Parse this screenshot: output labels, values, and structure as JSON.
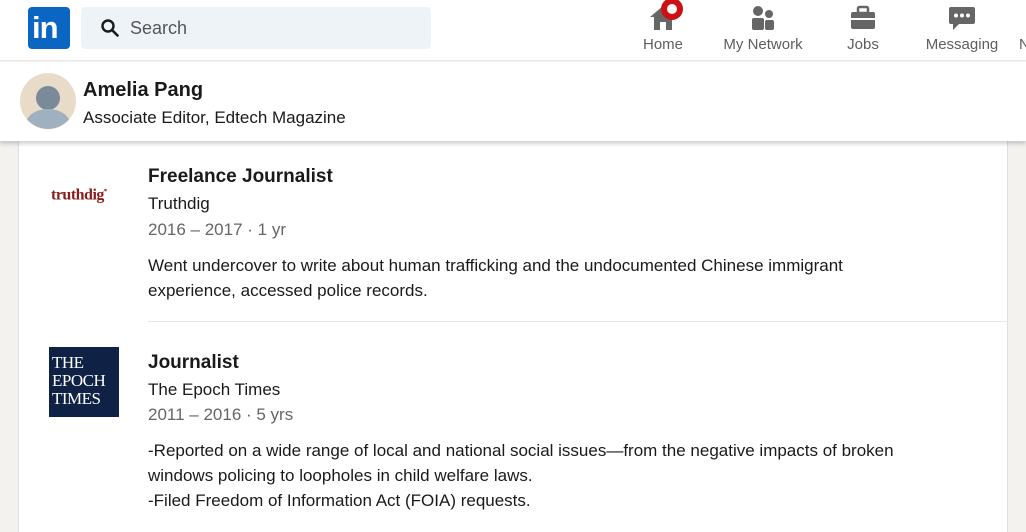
{
  "nav": {
    "logo_text": "in",
    "search_placeholder": "Search",
    "items": [
      {
        "label": "Home",
        "icon": "home-icon",
        "notification": true
      },
      {
        "label": "My Network",
        "icon": "people-icon"
      },
      {
        "label": "Jobs",
        "icon": "briefcase-icon"
      },
      {
        "label": "Messaging",
        "icon": "message-icon"
      }
    ],
    "cut_label": "N"
  },
  "profile": {
    "name": "Amelia Pang",
    "headline": "Associate Editor, Edtech Magazine"
  },
  "experience": [
    {
      "title": "Freelance Journalist",
      "company": "Truthdig",
      "logo_text": "truthdig",
      "dates": "2016 – 2017 · 1 yr",
      "description": [
        "Went undercover to write about human trafficking and the undocumented Chinese immigrant",
        "experience, accessed police records."
      ]
    },
    {
      "title": "Journalist",
      "company": "The Epoch Times",
      "logo_lines": [
        "THE",
        "EPOCH",
        "TIMES"
      ],
      "dates": "2011 – 2016 · 5 yrs",
      "description": [
        "-Reported on a wide range of local and national social issues—from the negative impacts of broken",
        "windows policing to loopholes in child welfare laws.",
        "-Filed Freedom of Information Act (FOIA) requests."
      ]
    }
  ],
  "colors": {
    "brand": "#0a66c2",
    "badge": "#cc1016",
    "epoch_bg": "#0f2145"
  }
}
